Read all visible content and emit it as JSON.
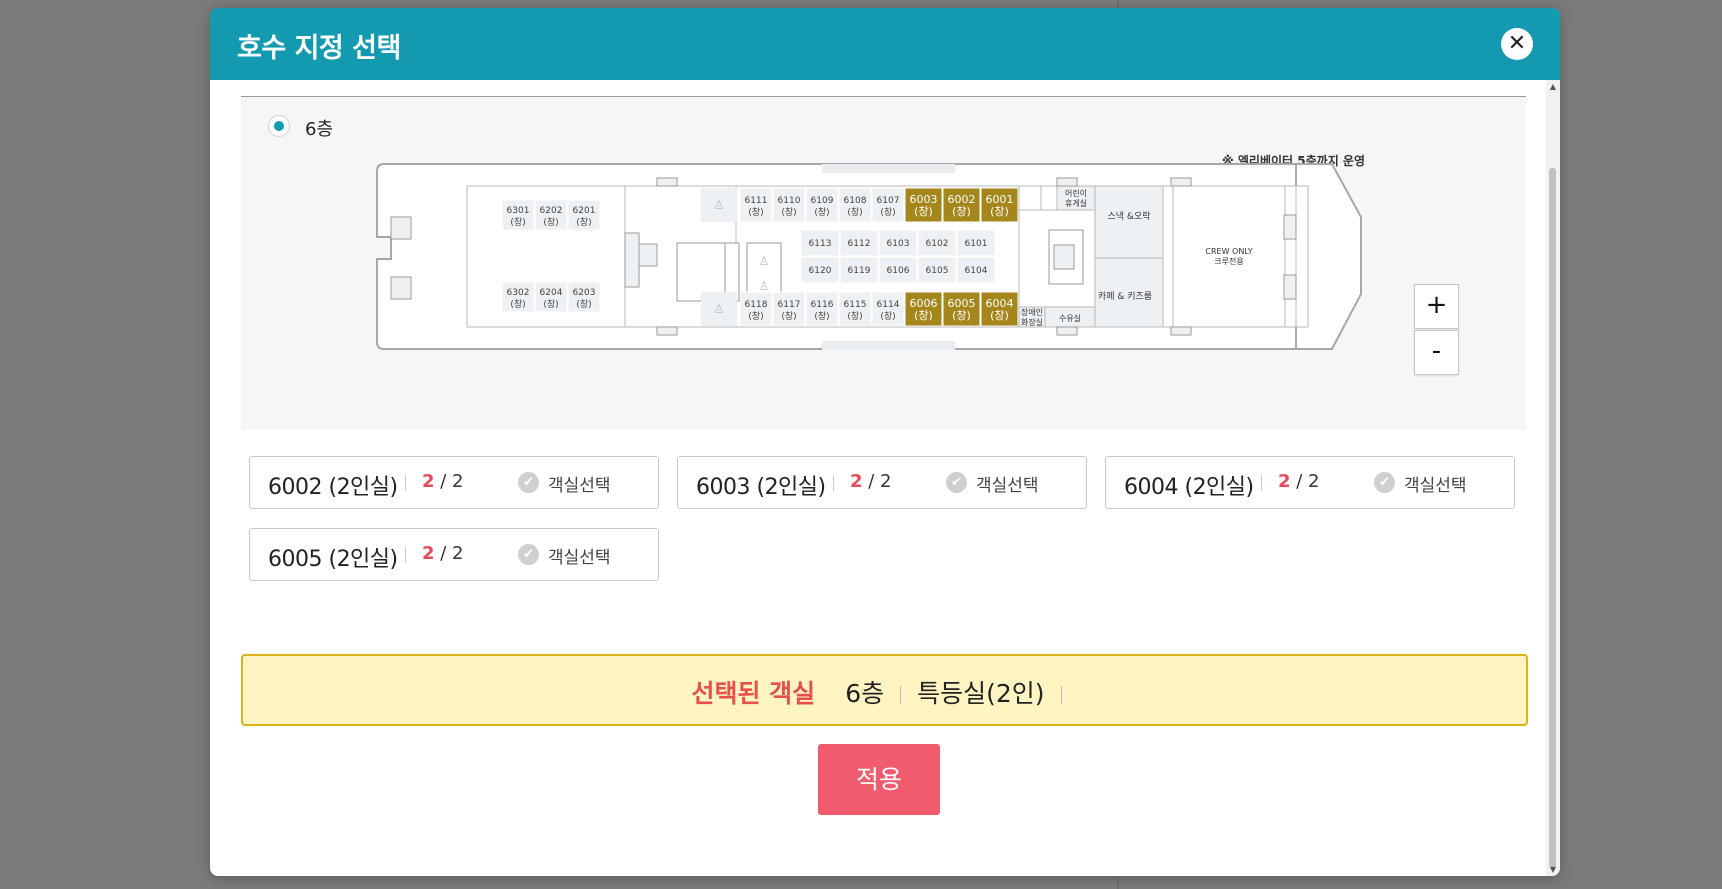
{
  "modal": {
    "title": "호수 지정 선택",
    "close_icon": "close-icon"
  },
  "floor": {
    "label": "6층",
    "notice": "※ 엘리베이터 5층까지 운영"
  },
  "ship_map": {
    "rooms_top": [
      "6111",
      "6110",
      "6109",
      "6108",
      "6107"
    ],
    "rooms_top_selected": [
      "6003",
      "6002",
      "6001"
    ],
    "rooms_mid1": [
      "6113",
      "6112",
      "6103",
      "6102",
      "6101"
    ],
    "rooms_mid2": [
      "6120",
      "6119",
      "6106",
      "6105",
      "6104"
    ],
    "rooms_bottom": [
      "6118",
      "6117",
      "6116",
      "6115",
      "6114"
    ],
    "rooms_bottom_selected": [
      "6006",
      "6005",
      "6004"
    ],
    "rooms_aft_top": [
      "6301",
      "6202",
      "6201"
    ],
    "rooms_aft_bottom": [
      "6302",
      "6204",
      "6203"
    ],
    "window_suffix": "(창)",
    "kids_lounge": "어린이\n휴게실",
    "snack_bar": "스낵 &오락",
    "cafe": "카페 & 키즈룸",
    "crew_only": "CREW ONLY",
    "crew_only_kr": "크루전용",
    "accessible_restroom": "장애인\n화장실",
    "nursing_room": "수유실",
    "selected_color": "#a5861b",
    "room_color": "#eef1f4"
  },
  "zoom": {
    "plus": "+",
    "minus": "-"
  },
  "room_cards": [
    {
      "name": "6002 (2인실)",
      "count_available": "2",
      "count_total": " / 2",
      "select_label": "객실선택"
    },
    {
      "name": "6003 (2인실)",
      "count_available": "2",
      "count_total": " / 2",
      "select_label": "객실선택"
    },
    {
      "name": "6004 (2인실)",
      "count_available": "2",
      "count_total": " / 2",
      "select_label": "객실선택"
    },
    {
      "name": "6005 (2인실)",
      "count_available": "2",
      "count_total": " / 2",
      "select_label": "객실선택"
    }
  ],
  "selected": {
    "title": "선택된 객실",
    "floor": "6층",
    "room_type": "특등실(2인)"
  },
  "apply_label": "적용"
}
